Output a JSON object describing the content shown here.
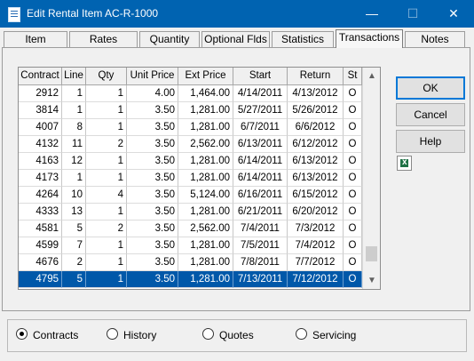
{
  "window": {
    "title": "Edit Rental Item AC-R-1000",
    "min_glyph": "—",
    "max_glyph": "☐",
    "close_glyph": "✕"
  },
  "tabs": [
    "Item",
    "Rates",
    "Quantity",
    "Optional Flds",
    "Statistics",
    "Transactions",
    "Notes"
  ],
  "active_tab": "Transactions",
  "table": {
    "columns": [
      "Contract",
      "Line",
      "Qty",
      "Unit Price",
      "Ext Price",
      "Start",
      "Return",
      "St"
    ],
    "rows": [
      [
        "2912",
        "1",
        "1",
        "4.00",
        "1,464.00",
        "4/14/2011",
        "4/13/2012",
        "O"
      ],
      [
        "3814",
        "1",
        "1",
        "3.50",
        "1,281.00",
        "5/27/2011",
        "5/26/2012",
        "O"
      ],
      [
        "4007",
        "8",
        "1",
        "3.50",
        "1,281.00",
        "6/7/2011",
        "6/6/2012",
        "O"
      ],
      [
        "4132",
        "11",
        "2",
        "3.50",
        "2,562.00",
        "6/13/2011",
        "6/12/2012",
        "O"
      ],
      [
        "4163",
        "12",
        "1",
        "3.50",
        "1,281.00",
        "6/14/2011",
        "6/13/2012",
        "O"
      ],
      [
        "4173",
        "1",
        "1",
        "3.50",
        "1,281.00",
        "6/14/2011",
        "6/13/2012",
        "O"
      ],
      [
        "4264",
        "10",
        "4",
        "3.50",
        "5,124.00",
        "6/16/2011",
        "6/15/2012",
        "O"
      ],
      [
        "4333",
        "13",
        "1",
        "3.50",
        "1,281.00",
        "6/21/2011",
        "6/20/2012",
        "O"
      ],
      [
        "4581",
        "5",
        "2",
        "3.50",
        "2,562.00",
        "7/4/2011",
        "7/3/2012",
        "O"
      ],
      [
        "4599",
        "7",
        "1",
        "3.50",
        "1,281.00",
        "7/5/2011",
        "7/4/2012",
        "O"
      ],
      [
        "4676",
        "2",
        "1",
        "3.50",
        "1,281.00",
        "7/8/2011",
        "7/7/2012",
        "O"
      ],
      [
        "4795",
        "5",
        "1",
        "3.50",
        "1,281.00",
        "7/13/2011",
        "7/12/2012",
        "O"
      ]
    ],
    "selected_row_index": 11,
    "scroll": {
      "up_glyph": "▲",
      "down_glyph": "▼",
      "thumb_position_fraction": 0.94,
      "visible_fraction": 0.08
    }
  },
  "buttons": {
    "ok": "OK",
    "cancel": "Cancel",
    "help": "Help"
  },
  "icons": {
    "export": "excel-export-icon"
  },
  "radios": [
    {
      "label": "Contracts",
      "checked": true
    },
    {
      "label": "History",
      "checked": false
    },
    {
      "label": "Quotes",
      "checked": false
    },
    {
      "label": "Servicing",
      "checked": false
    }
  ],
  "colors": {
    "titlebar": "#0063b1",
    "selection": "#0058a9"
  }
}
